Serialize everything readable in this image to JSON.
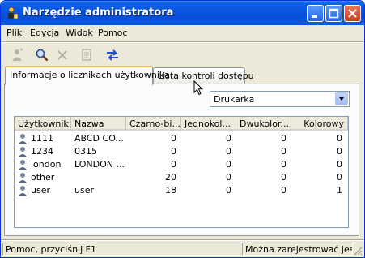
{
  "window": {
    "title": "Narzędzie administratora"
  },
  "titlebar_buttons": {
    "minimize": "minimize-icon",
    "maximize": "maximize-icon",
    "close": "close-icon"
  },
  "menu": [
    "Plik",
    "Edycja",
    "Widok",
    "Pomoc"
  ],
  "toolbar": [
    "add-user-icon",
    "search-icon",
    "delete-icon",
    "properties-icon",
    "refresh-icon"
  ],
  "tabs": [
    "Informacje o licznikach użytkownika",
    "Lista kontroli dostępu"
  ],
  "combo": {
    "selected": "Drukarka"
  },
  "table": {
    "columns": [
      "Użytkownik",
      "Nazwa",
      "Czarno-bi...",
      "Jednokol...",
      "Dwukolor...",
      "Kolorowy"
    ],
    "rows": [
      [
        "1111",
        "ABCD CO...",
        "0",
        "0",
        "0",
        "0"
      ],
      [
        "1234",
        "0315",
        "0",
        "0",
        "0",
        "0"
      ],
      [
        "london",
        "LONDON ...",
        "0",
        "0",
        "0",
        "0"
      ],
      [
        "other",
        "",
        "20",
        "0",
        "0",
        "0"
      ],
      [
        "user",
        "user",
        "18",
        "0",
        "0",
        "1"
      ]
    ]
  },
  "status": {
    "left": "Pomoc, przyciśnij F1",
    "right": "Można zarejestrować jeszc"
  },
  "colors": {
    "title_blue": "#0a55de",
    "tab_highlight": "#ffc83c",
    "face": "#ece9d8"
  }
}
